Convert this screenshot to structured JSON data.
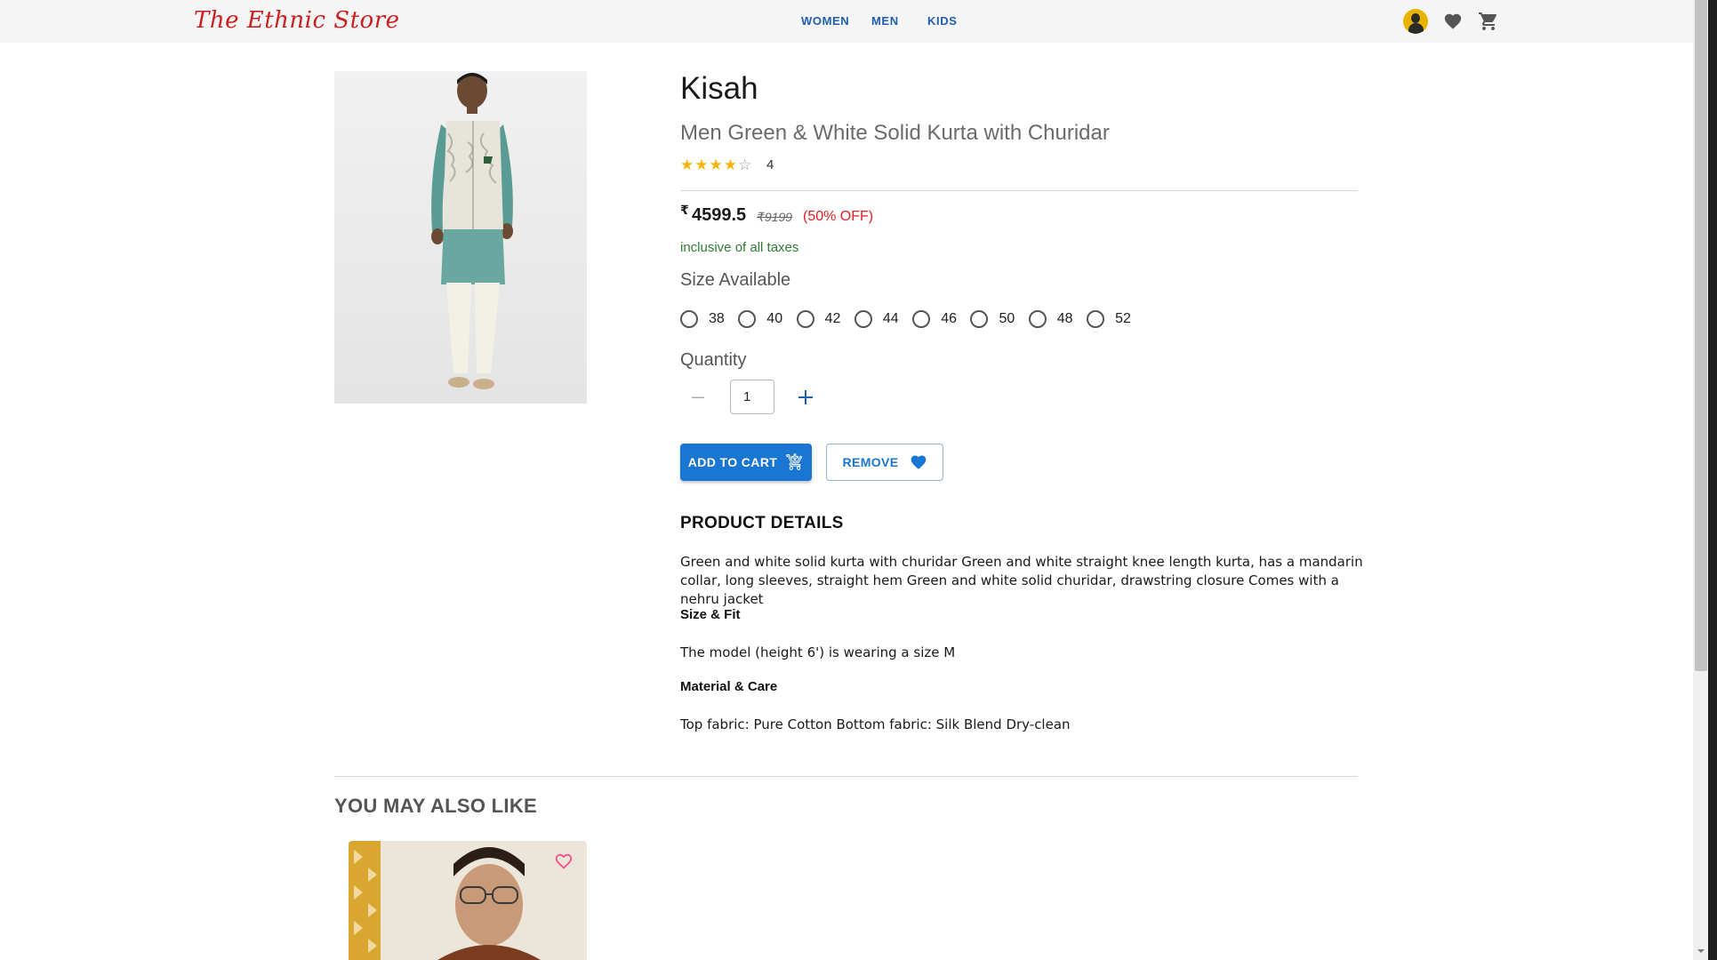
{
  "header": {
    "logo_text": "The Ethnic Store",
    "nav": [
      {
        "label": "WOMEN"
      },
      {
        "label": "MEN"
      },
      {
        "label": "KIDS"
      }
    ],
    "icons": [
      "avatar",
      "heart-icon",
      "cart-icon"
    ]
  },
  "product": {
    "brand": "Kisah",
    "name": "Men Green & White Solid Kurta with Churidar",
    "rating": {
      "value": "4",
      "stars": 4,
      "max": 5
    },
    "price_symbol": "₹",
    "price": "4599.5",
    "mrp": "₹9199",
    "discount": "(50% OFF)",
    "taxes_note": "inclusive of all taxes",
    "size_title": "Size Available",
    "sizes": [
      {
        "label": "38"
      },
      {
        "label": "40"
      },
      {
        "label": "42"
      },
      {
        "label": "44"
      },
      {
        "label": "46"
      },
      {
        "label": "50"
      },
      {
        "label": "48"
      },
      {
        "label": "52"
      }
    ],
    "quantity_title": "Quantity",
    "quantity_value": "1",
    "add_to_cart_label": "ADD TO CART",
    "remove_label": "REMOVE"
  },
  "details": {
    "title": "PRODUCT DETAILS",
    "description": "Green and white solid kurta with churidar Green and white straight knee length kurta, has a mandarin collar, long sleeves, straight hem Green and white solid churidar, drawstring closure Comes with a nehru jacket",
    "size_fit_title": "Size & Fit",
    "size_fit_text": "The model (height 6') is wearing a size M",
    "material_title": "Material & Care",
    "material_text": "Top fabric: Pure Cotton Bottom fabric: Silk Blend Dry-clean"
  },
  "recommendations": {
    "title": "YOU MAY ALSO LIKE"
  },
  "colors": {
    "primary": "#1976d2",
    "logo": "#cc1f1f",
    "star": "#f5b50a",
    "discount": "#e02020",
    "taxes": "#2e7d32",
    "wishlist_heart": "#ff4f8b"
  }
}
